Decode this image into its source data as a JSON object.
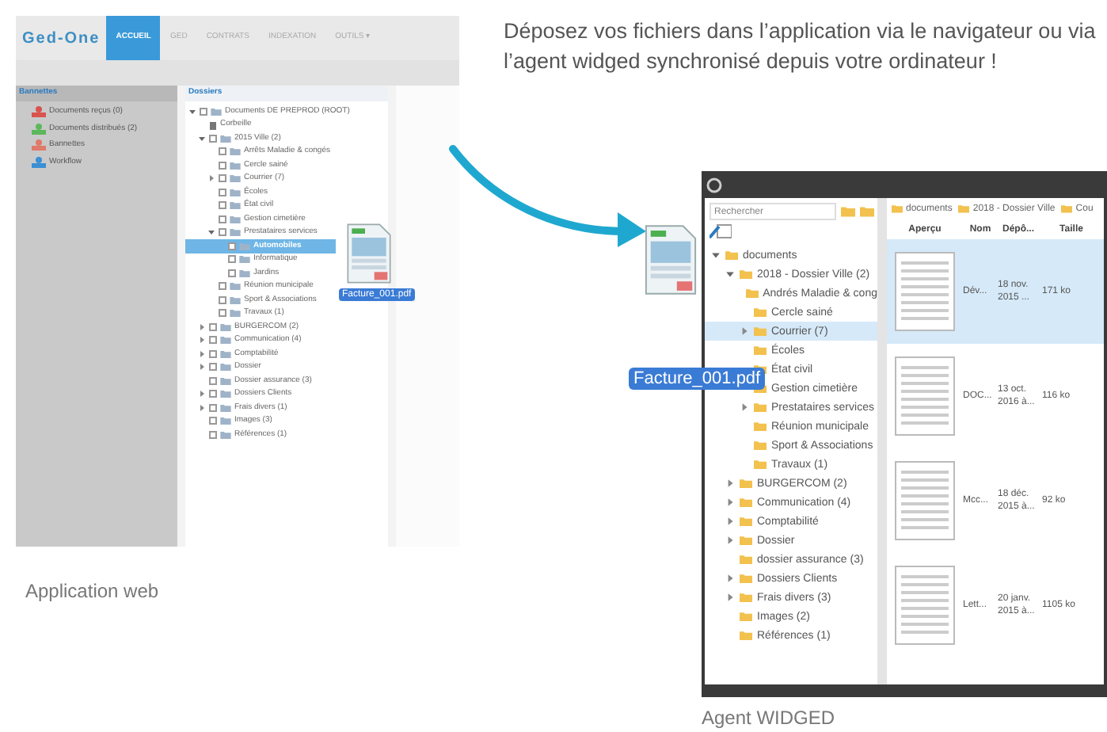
{
  "headline": "Déposez vos fichiers dans l’application via le navigateur ou via l’agent widged synchronisé depuis votre ordinateur !",
  "web_app": {
    "caption": "Application web",
    "logo": "Ged-One",
    "nav_tabs": [
      {
        "label": "ACCUEIL",
        "selected": true
      },
      {
        "label": "GED",
        "selected": false
      },
      {
        "label": "CONTRATS",
        "selected": false
      },
      {
        "label": "INDEXATION",
        "selected": false
      },
      {
        "label": "OUTILS ▾",
        "selected": false
      }
    ],
    "sidebar": {
      "title": "Bannettes",
      "items": [
        {
          "label": "Documents reçus (0)",
          "color": "#d9534f"
        },
        {
          "label": "Documents distribués (2)",
          "color": "#5cb85c"
        },
        {
          "label": "Bannettes",
          "color": "#e07a6a"
        },
        {
          "label": "Workflow",
          "color": "#3a8fd6"
        }
      ]
    },
    "tree": {
      "title": "Dossiers",
      "items": [
        {
          "label": "Documents DE PREPROD (ROOT)",
          "selected": false,
          "expanded": true,
          "children": [
            {
              "label": "Corbeille",
              "kind": "trash",
              "selected": false
            },
            {
              "label": "2015 Ville (2)",
              "selected": false,
              "expanded": true,
              "children": [
                {
                  "label": "Arrêts Maladie & congés",
                  "selected": false
                },
                {
                  "label": "Cercle sainé",
                  "selected": false
                },
                {
                  "label": "Courrier (7)",
                  "selected": false,
                  "expanded": false
                },
                {
                  "label": "Écoles",
                  "selected": false
                },
                {
                  "label": "État civil",
                  "selected": false
                },
                {
                  "label": "Gestion cimetière",
                  "selected": false
                },
                {
                  "label": "Prestataires services",
                  "selected": false,
                  "expanded": true,
                  "children": [
                    {
                      "label": "Automobiles",
                      "selected": true
                    },
                    {
                      "label": "Informatique",
                      "selected": false
                    },
                    {
                      "label": "Jardins",
                      "selected": false
                    }
                  ]
                },
                {
                  "label": "Réunion municipale",
                  "selected": false
                },
                {
                  "label": "Sport & Associations",
                  "selected": false
                },
                {
                  "label": "Travaux (1)",
                  "selected": false
                }
              ]
            },
            {
              "label": "BURGERCOM (2)",
              "selected": false,
              "expanded": false
            },
            {
              "label": "Communication (4)",
              "selected": false,
              "expanded": false
            },
            {
              "label": "Comptabilité",
              "selected": false,
              "expanded": false
            },
            {
              "label": "Dossier",
              "selected": false,
              "expanded": false
            },
            {
              "label": "Dossier assurance (3)",
              "selected": false
            },
            {
              "label": "Dossiers Clients",
              "selected": false,
              "expanded": false
            },
            {
              "label": "Frais divers (1)",
              "selected": false,
              "expanded": false
            },
            {
              "label": "Images (3)",
              "selected": false
            },
            {
              "label": "Références (1)",
              "selected": false
            }
          ]
        }
      ]
    },
    "dragged_file": "Facture_001.pdf"
  },
  "agent": {
    "caption": "Agent WIDGED",
    "search": {
      "placeholder": "Rechercher"
    },
    "tree": [
      {
        "label": "documents",
        "selected": false,
        "expanded": true,
        "children": [
          {
            "label": "2018 - Dossier Ville (2)",
            "selected": false,
            "expanded": true,
            "children": [
              {
                "label": "Andrés Maladie & cong",
                "selected": false
              },
              {
                "label": "Cercle sainé",
                "selected": false
              },
              {
                "label": "Courrier (7)",
                "selected": true,
                "expanded": false
              },
              {
                "label": "Écoles",
                "selected": false
              },
              {
                "label": "État civil",
                "selected": false
              },
              {
                "label": "Gestion cimetière",
                "selected": false
              },
              {
                "label": "Prestataires services",
                "selected": false,
                "expanded": false
              },
              {
                "label": "Réunion municipale",
                "selected": false
              },
              {
                "label": "Sport & Associations",
                "selected": false
              },
              {
                "label": "Travaux (1)",
                "selected": false
              }
            ]
          },
          {
            "label": "BURGERCOM (2)",
            "selected": false,
            "expanded": false
          },
          {
            "label": "Communication (4)",
            "selected": false,
            "expanded": false
          },
          {
            "label": "Comptabilité",
            "selected": false,
            "expanded": false
          },
          {
            "label": "Dossier",
            "selected": false,
            "expanded": false
          },
          {
            "label": "dossier assurance (3)",
            "selected": false
          },
          {
            "label": "Dossiers Clients",
            "selected": false,
            "expanded": false
          },
          {
            "label": "Frais divers (3)",
            "selected": false,
            "expanded": false
          },
          {
            "label": "Images (2)",
            "selected": false
          },
          {
            "label": "Références (1)",
            "selected": false
          }
        ]
      }
    ],
    "breadcrumb": [
      "documents",
      "2018 - Dossier Ville",
      "Cou"
    ],
    "columns": [
      "Aperçu",
      "Nom",
      "Dépô...",
      "Taille"
    ],
    "rows": [
      {
        "name": "Dév...",
        "date": "18 nov. 2015 ...",
        "size": "171 ko",
        "selected": true
      },
      {
        "name": "DOC...",
        "date": "13 oct. 2016 à...",
        "size": "116 ko",
        "selected": false
      },
      {
        "name": "Mcc...",
        "date": "18 déc. 2015 à...",
        "size": "92 ko",
        "selected": false
      },
      {
        "name": "Lett...",
        "date": "20 janv. 2015 à...",
        "size": "1105 ko",
        "selected": false
      }
    ],
    "dragged_file": "Facture_001.pdf"
  }
}
